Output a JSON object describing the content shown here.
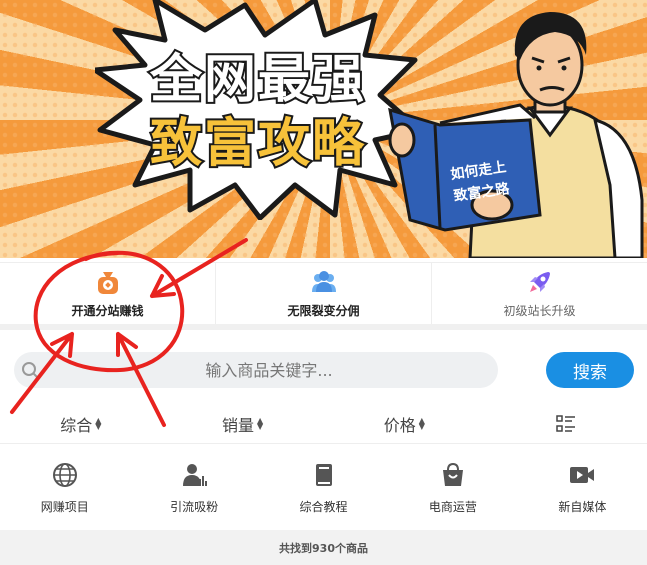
{
  "banner": {
    "headline_line1": "全网最强",
    "headline_line2": "致富攻略",
    "book_line1": "如何走上",
    "book_line2": "致富之路"
  },
  "features": [
    {
      "label": "开通分站赚钱",
      "icon": "money-bag-icon",
      "color": "#f0873a"
    },
    {
      "label": "无限裂变分佣",
      "icon": "users-icon",
      "color": "#4a90e2"
    },
    {
      "label": "初级站长升级",
      "icon": "rocket-icon",
      "color": "#7a5cf0"
    }
  ],
  "search": {
    "placeholder": "输入商品关键字...",
    "button_label": "搜索"
  },
  "sort": {
    "overall": "综合",
    "sales": "销量",
    "price": "价格",
    "view_icon": "list-view-icon"
  },
  "categories": [
    {
      "label": "网赚项目",
      "icon": "globe-icon"
    },
    {
      "label": "引流吸粉",
      "icon": "user-stats-icon"
    },
    {
      "label": "综合教程",
      "icon": "book-icon"
    },
    {
      "label": "电商运营",
      "icon": "shopping-bag-icon"
    },
    {
      "label": "新自媒体",
      "icon": "video-icon"
    }
  ],
  "result_count_text": "共找到930个商品",
  "colors": {
    "accent": "#1a8fe3",
    "annotation": "#e8231f",
    "banner_orange": "#f59a3c"
  }
}
